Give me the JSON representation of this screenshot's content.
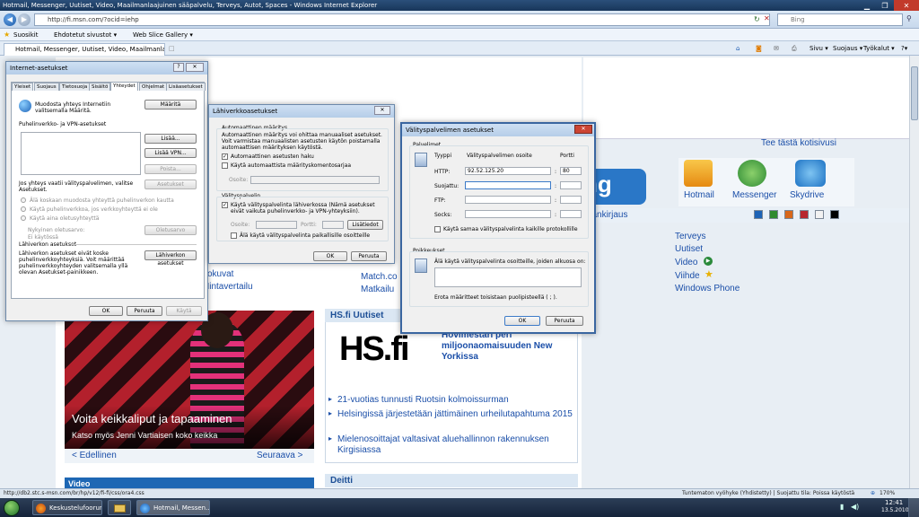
{
  "window": {
    "title": "Hotmail, Messenger, Uutiset, Video, Maailmanlaajuinen sääpalvelu, Terveys, Autot, Spaces - Windows Internet Explorer"
  },
  "address": {
    "url": "http://fi.msn.com/?ocid=iehp",
    "search_placeholder": "Bing"
  },
  "favorites": {
    "label": "Suosikit",
    "items": [
      "Ehdotetut sivustot ▾",
      "Web Slice Gallery ▾"
    ]
  },
  "tab": {
    "title": "Hotmail, Messenger, Uutiset, Video, Maailmanlaa..."
  },
  "command_bar": {
    "items": [
      "Sivu ▾",
      "Suojaus ▾",
      "Työkalut ▾",
      "?▾"
    ]
  },
  "msn": {
    "set_home": "Tee tästä kotisivusi",
    "search_logo_fragment": "ng",
    "signup": "Sisäänkirjaus",
    "services": [
      "Hotmail",
      "Messenger",
      "Skydrive"
    ],
    "theme_colors": [
      "#1d63b6",
      "#2f8a2f",
      "#d8681b",
      "#b8262f",
      "#f2f2f2",
      "#000000"
    ],
    "links_right": [
      "Terveys",
      "Uutiset",
      "Video",
      "Viihde",
      "Windows Phone"
    ],
    "links_left_partial": [
      "Ilokuvat",
      "Hintavertailu"
    ],
    "links_mid_partial": [
      "Match.co",
      "Matkailu"
    ],
    "promo_caption": "Voita keikkaliput ja tapaaminen",
    "promo_sub": "Katso myös Jenni Vartiaisen koko keikka",
    "prev": "< Edellinen",
    "next": "Seuraava >",
    "video_head": "Video",
    "hs_head": "HS.fi Uutiset",
    "hs_logo": "HS.fi",
    "hs_top_story": "Hovimestari peri miljoonaomaisuuden New Yorkissa",
    "hs_news": [
      "21-vuotias tunnusti Ruotsin kolmoissurman",
      "Helsingissä järjestetään jättimäinen urheilutapahtuma 2015",
      "Mielenosoittajat valtasivat aluehallinnon rakennuksen Kirgisiassa"
    ],
    "deitti_head": "Deitti"
  },
  "internet_options": {
    "title": "Internet-asetukset",
    "tabs": [
      "Yleiset",
      "Suojaus",
      "Tietosuoja",
      "Sisältö",
      "Yhteydet",
      "Ohjelmat",
      "Lisäasetukset"
    ],
    "active_tab": "Yhteydet",
    "setup_text": "Muodosta yhteys Internetiin valitsemalla Määritä.",
    "setup_button": "Määritä",
    "dialup_heading": "Puhelinverkko- ja VPN-asetukset",
    "add_button": "Lisää...",
    "add_vpn_button": "Lisää VPN...",
    "remove_button": "Poista...",
    "settings_button": "Asetukset",
    "proxy_note": "Jos yhteys vaatii välityspalvelimen, valitse Asetukset.",
    "radio_options": [
      "Älä koskaan muodosta yhteyttä puhelinverkon kautta",
      "Käytä puhelinverkkoa, jos verkkoyhteyttä ei ole",
      "Käytä aina oletusyhteyttä"
    ],
    "current_label": "Nykyinen oletusarvo:",
    "current_value": "Ei käytössä",
    "default_button": "Oletusarvo",
    "lan_heading": "Lähiverkon asetukset",
    "lan_text": "Lähiverkon asetukset eivät koske puhelinverkkoyhteyksiä. Voit määrittää puhelinverkkoyhteyden valitsemalla yllä olevan Asetukset-painikkeen.",
    "lan_button": "Lähiverkon asetukset",
    "ok": "OK",
    "cancel": "Peruuta",
    "apply": "Käytä"
  },
  "lan_settings": {
    "title": "Lähiverkkoasetukset",
    "auto_heading": "Automaattinen määritys",
    "auto_text": "Automaattinen määritys voi ohittaa manuaaliset asetukset. Voit varmistaa manuaalisten asetusten käytön poistamalla automaattisen määrityksen käytöstä.",
    "auto_detect": "Automaattinen asetusten haku",
    "auto_detect_checked": true,
    "use_script": "Käytä automaattista määrityskomentosarjaa",
    "use_script_checked": false,
    "address_label": "Osoite:",
    "proxy_heading": "Välityspalvelin",
    "use_proxy": "Käytä välityspalvelinta lähiverkossa (Nämä asetukset eivät vaikuta puhelinverkko- ja VPN-yhteyksiin).",
    "use_proxy_checked": true,
    "addr_label": "Osoite:",
    "port_label": "Portti:",
    "advanced_button": "Lisätiedot",
    "bypass_local": "Älä käytä välityspalvelinta paikallisille osoitteille",
    "bypass_local_checked": false,
    "ok": "OK",
    "cancel": "Peruuta"
  },
  "proxy_settings": {
    "title": "Välityspalvelimen asetukset",
    "servers_heading": "Palvelimet",
    "col_type": "Tyyppi",
    "col_address": "Välityspalvelimen osoite",
    "col_port": "Portti",
    "rows": [
      {
        "type": "HTTP:",
        "address": "92.52.125.20",
        "port": "80"
      },
      {
        "type": "Suojattu:",
        "address": "",
        "port": ""
      },
      {
        "type": "FTP:",
        "address": "",
        "port": ""
      },
      {
        "type": "Socks:",
        "address": "",
        "port": ""
      }
    ],
    "same_for_all": "Käytä samaa välityspalvelinta kaikille protokollille",
    "same_for_all_checked": false,
    "exceptions_heading": "Poikkeukset",
    "exceptions_text": "Älä käytä välityspalvelinta osoitteille, joiden alkuosa on:",
    "exceptions_value": "",
    "separator_note": "Erota määritteet toisistaan puolipisteellä ( ; ).",
    "ok": "OK",
    "cancel": "Peruuta"
  },
  "status": {
    "url": "http://db2.stc.s-msn.com/br/hp/v12/fi-fi/css/ora4.css",
    "zone": "Tuntematon vyöhyke (Yhdistetty) | Suojattu tila: Poissa käytöstä",
    "zoom": "170%"
  },
  "taskbar": {
    "tasks": [
      "Keskustelufoorum ...",
      "",
      "Hotmail, Messen..."
    ],
    "time": "12:41",
    "date": "13.5.2010"
  }
}
